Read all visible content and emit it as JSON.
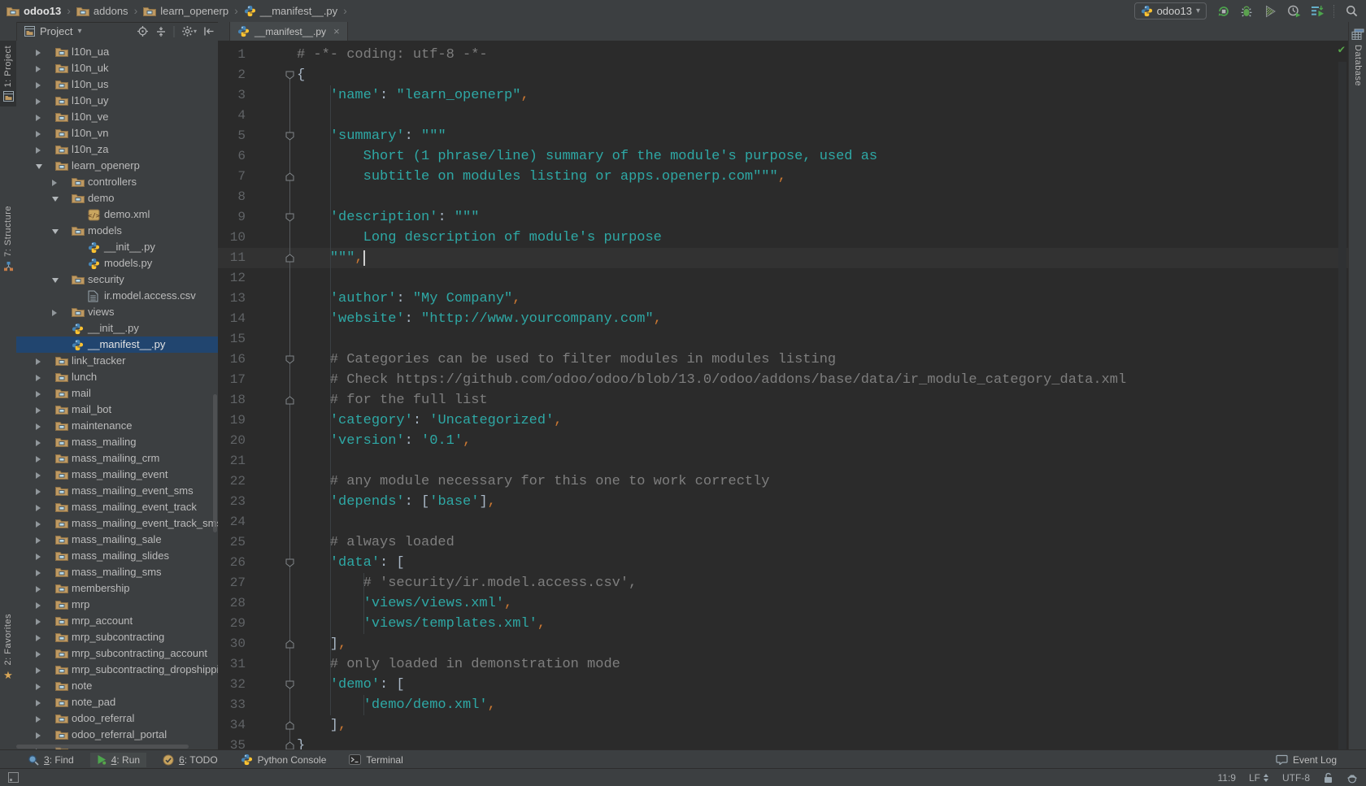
{
  "colors": {
    "panel_bg": "#3C3F41",
    "editor_bg": "#2B2B2B",
    "selection_blue": "#21456F",
    "string_teal": "#2EA8A5",
    "comment_gray": "#7E7E7E",
    "comma_orange": "#CC7832",
    "punct_gray": "#A9B7C6",
    "run_green": "#4DA54D",
    "check_green": "#57A64A",
    "folder_tan": "#BE9962"
  },
  "breadcrumb": {
    "items": [
      {
        "label": "odoo13",
        "icon": "folder",
        "bold": true
      },
      {
        "label": "addons",
        "icon": "folder"
      },
      {
        "label": "learn_openerp",
        "icon": "folder"
      },
      {
        "label": "__manifest__.py",
        "icon": "python"
      }
    ]
  },
  "run_area": {
    "config_label": "odoo13",
    "config_icon": "python",
    "dropdown_caret": "▾",
    "buttons": [
      "rerun",
      "debug",
      "coverage",
      "profile",
      "services"
    ],
    "search_button": "search-everywhere"
  },
  "left_stripe": {
    "top": [
      {
        "label": "1: Project",
        "icon": "project-tool",
        "active": true
      },
      {
        "label": "7: Structure",
        "icon": "structure-tool",
        "active": false
      }
    ],
    "bottom": [
      {
        "label": "2: Favorites",
        "icon": "favorites-star",
        "active": false
      }
    ]
  },
  "right_stripe": {
    "items": [
      {
        "label": "Database",
        "icon": "database-tool"
      }
    ]
  },
  "project_panel": {
    "title": "Project",
    "title_icon": "project-tool",
    "caret": "▾",
    "header_icons": [
      "locate",
      "collapse-all",
      "separator",
      "settings",
      "hide-panel"
    ],
    "tree": [
      {
        "label": "l10n_ua",
        "level": 1,
        "icon": "folder",
        "arrow": "collapsed"
      },
      {
        "label": "l10n_uk",
        "level": 1,
        "icon": "folder",
        "arrow": "collapsed"
      },
      {
        "label": "l10n_us",
        "level": 1,
        "icon": "folder",
        "arrow": "collapsed"
      },
      {
        "label": "l10n_uy",
        "level": 1,
        "icon": "folder",
        "arrow": "collapsed"
      },
      {
        "label": "l10n_ve",
        "level": 1,
        "icon": "folder",
        "arrow": "collapsed"
      },
      {
        "label": "l10n_vn",
        "level": 1,
        "icon": "folder",
        "arrow": "collapsed"
      },
      {
        "label": "l10n_za",
        "level": 1,
        "icon": "folder",
        "arrow": "collapsed"
      },
      {
        "label": "learn_openerp",
        "level": 1,
        "icon": "folder",
        "arrow": "expanded"
      },
      {
        "label": "controllers",
        "level": 2,
        "icon": "folder",
        "arrow": "collapsed"
      },
      {
        "label": "demo",
        "level": 2,
        "icon": "folder",
        "arrow": "expanded"
      },
      {
        "label": "demo.xml",
        "level": 3,
        "icon": "xml",
        "arrow": null
      },
      {
        "label": "models",
        "level": 2,
        "icon": "folder",
        "arrow": "expanded"
      },
      {
        "label": "__init__.py",
        "level": 3,
        "icon": "python",
        "arrow": null
      },
      {
        "label": "models.py",
        "level": 3,
        "icon": "python",
        "arrow": null
      },
      {
        "label": "security",
        "level": 2,
        "icon": "folder",
        "arrow": "expanded"
      },
      {
        "label": "ir.model.access.csv",
        "level": 3,
        "icon": "csv",
        "arrow": null
      },
      {
        "label": "views",
        "level": 2,
        "icon": "folder",
        "arrow": "collapsed"
      },
      {
        "label": "__init__.py",
        "level": 2,
        "icon": "python",
        "arrow": null
      },
      {
        "label": "__manifest__.py",
        "level": 2,
        "icon": "python",
        "arrow": null,
        "selected": true
      },
      {
        "label": "link_tracker",
        "level": 1,
        "icon": "folder",
        "arrow": "collapsed"
      },
      {
        "label": "lunch",
        "level": 1,
        "icon": "folder",
        "arrow": "collapsed"
      },
      {
        "label": "mail",
        "level": 1,
        "icon": "folder",
        "arrow": "collapsed"
      },
      {
        "label": "mail_bot",
        "level": 1,
        "icon": "folder",
        "arrow": "collapsed"
      },
      {
        "label": "maintenance",
        "level": 1,
        "icon": "folder",
        "arrow": "collapsed"
      },
      {
        "label": "mass_mailing",
        "level": 1,
        "icon": "folder",
        "arrow": "collapsed"
      },
      {
        "label": "mass_mailing_crm",
        "level": 1,
        "icon": "folder",
        "arrow": "collapsed"
      },
      {
        "label": "mass_mailing_event",
        "level": 1,
        "icon": "folder",
        "arrow": "collapsed"
      },
      {
        "label": "mass_mailing_event_sms",
        "level": 1,
        "icon": "folder",
        "arrow": "collapsed"
      },
      {
        "label": "mass_mailing_event_track",
        "level": 1,
        "icon": "folder",
        "arrow": "collapsed"
      },
      {
        "label": "mass_mailing_event_track_sms",
        "level": 1,
        "icon": "folder",
        "arrow": "collapsed"
      },
      {
        "label": "mass_mailing_sale",
        "level": 1,
        "icon": "folder",
        "arrow": "collapsed"
      },
      {
        "label": "mass_mailing_slides",
        "level": 1,
        "icon": "folder",
        "arrow": "collapsed"
      },
      {
        "label": "mass_mailing_sms",
        "level": 1,
        "icon": "folder",
        "arrow": "collapsed"
      },
      {
        "label": "membership",
        "level": 1,
        "icon": "folder",
        "arrow": "collapsed"
      },
      {
        "label": "mrp",
        "level": 1,
        "icon": "folder",
        "arrow": "collapsed"
      },
      {
        "label": "mrp_account",
        "level": 1,
        "icon": "folder",
        "arrow": "collapsed"
      },
      {
        "label": "mrp_subcontracting",
        "level": 1,
        "icon": "folder",
        "arrow": "collapsed"
      },
      {
        "label": "mrp_subcontracting_account",
        "level": 1,
        "icon": "folder",
        "arrow": "collapsed"
      },
      {
        "label": "mrp_subcontracting_dropshipping",
        "level": 1,
        "icon": "folder",
        "arrow": "collapsed"
      },
      {
        "label": "note",
        "level": 1,
        "icon": "folder",
        "arrow": "collapsed"
      },
      {
        "label": "note_pad",
        "level": 1,
        "icon": "folder",
        "arrow": "collapsed"
      },
      {
        "label": "odoo_referral",
        "level": 1,
        "icon": "folder",
        "arrow": "collapsed"
      },
      {
        "label": "odoo_referral_portal",
        "level": 1,
        "icon": "folder",
        "arrow": "collapsed"
      },
      {
        "label": "",
        "level": 1,
        "icon": "folder",
        "arrow": "collapsed",
        "partial": true
      }
    ]
  },
  "editor": {
    "tab": {
      "label": "__manifest__.py",
      "icon": "python",
      "close_glyph": "×"
    },
    "inspection_status_icon": "checkmark",
    "caret": {
      "line": 11,
      "col": 9
    },
    "lines": [
      {
        "n": 1,
        "fold": null,
        "tokens": [
          [
            "c",
            "# -*- coding: utf-8 -*-"
          ]
        ]
      },
      {
        "n": 2,
        "fold": "start",
        "tokens": [
          [
            "p",
            "{"
          ]
        ]
      },
      {
        "n": 3,
        "fold": null,
        "tokens": [
          [
            "p",
            "    "
          ],
          [
            "s",
            "'name'"
          ],
          [
            "p",
            ": "
          ],
          [
            "s",
            "\"learn_openerp\""
          ],
          [
            "o",
            ","
          ]
        ]
      },
      {
        "n": 4,
        "fold": null,
        "tokens": []
      },
      {
        "n": 5,
        "fold": "start",
        "tokens": [
          [
            "p",
            "    "
          ],
          [
            "s",
            "'summary'"
          ],
          [
            "p",
            ": "
          ],
          [
            "s",
            "\"\"\""
          ]
        ]
      },
      {
        "n": 6,
        "fold": null,
        "tokens": [
          [
            "s",
            "        Short (1 phrase/line) summary of the module's purpose, used as"
          ]
        ]
      },
      {
        "n": 7,
        "fold": "end",
        "tokens": [
          [
            "s",
            "        subtitle on modules listing or apps.openerp.com\"\"\""
          ],
          [
            "o",
            ","
          ]
        ]
      },
      {
        "n": 8,
        "fold": null,
        "tokens": []
      },
      {
        "n": 9,
        "fold": "start",
        "tokens": [
          [
            "p",
            "    "
          ],
          [
            "s",
            "'description'"
          ],
          [
            "p",
            ": "
          ],
          [
            "s",
            "\"\"\""
          ]
        ]
      },
      {
        "n": 10,
        "fold": null,
        "tokens": [
          [
            "s",
            "        Long description of module's purpose"
          ]
        ]
      },
      {
        "n": 11,
        "fold": "end",
        "current": true,
        "tokens": [
          [
            "p",
            "    "
          ],
          [
            "s",
            "\"\"\""
          ],
          [
            "o",
            ","
          ]
        ]
      },
      {
        "n": 12,
        "fold": null,
        "tokens": []
      },
      {
        "n": 13,
        "fold": null,
        "tokens": [
          [
            "p",
            "    "
          ],
          [
            "s",
            "'author'"
          ],
          [
            "p",
            ": "
          ],
          [
            "s",
            "\"My Company\""
          ],
          [
            "o",
            ","
          ]
        ]
      },
      {
        "n": 14,
        "fold": null,
        "tokens": [
          [
            "p",
            "    "
          ],
          [
            "s",
            "'website'"
          ],
          [
            "p",
            ": "
          ],
          [
            "s",
            "\"http://www.yourcompany.com\""
          ],
          [
            "o",
            ","
          ]
        ]
      },
      {
        "n": 15,
        "fold": null,
        "tokens": []
      },
      {
        "n": 16,
        "fold": "start",
        "tokens": [
          [
            "c",
            "    # Categories can be used to filter modules in modules listing"
          ]
        ]
      },
      {
        "n": 17,
        "fold": null,
        "tokens": [
          [
            "c",
            "    # Check https://github.com/odoo/odoo/blob/13.0/odoo/addons/base/data/ir_module_category_data.xml"
          ]
        ]
      },
      {
        "n": 18,
        "fold": "end",
        "tokens": [
          [
            "c",
            "    # for the full list"
          ]
        ]
      },
      {
        "n": 19,
        "fold": null,
        "tokens": [
          [
            "p",
            "    "
          ],
          [
            "s",
            "'category'"
          ],
          [
            "p",
            ": "
          ],
          [
            "s",
            "'Uncategorized'"
          ],
          [
            "o",
            ","
          ]
        ]
      },
      {
        "n": 20,
        "fold": null,
        "tokens": [
          [
            "p",
            "    "
          ],
          [
            "s",
            "'version'"
          ],
          [
            "p",
            ": "
          ],
          [
            "s",
            "'0.1'"
          ],
          [
            "o",
            ","
          ]
        ]
      },
      {
        "n": 21,
        "fold": null,
        "tokens": []
      },
      {
        "n": 22,
        "fold": null,
        "tokens": [
          [
            "c",
            "    # any module necessary for this one to work correctly"
          ]
        ]
      },
      {
        "n": 23,
        "fold": null,
        "tokens": [
          [
            "p",
            "    "
          ],
          [
            "s",
            "'depends'"
          ],
          [
            "p",
            ": ["
          ],
          [
            "s",
            "'base'"
          ],
          [
            "p",
            "]"
          ],
          [
            "o",
            ","
          ]
        ]
      },
      {
        "n": 24,
        "fold": null,
        "tokens": []
      },
      {
        "n": 25,
        "fold": null,
        "tokens": [
          [
            "c",
            "    # always loaded"
          ]
        ]
      },
      {
        "n": 26,
        "fold": "start",
        "tokens": [
          [
            "p",
            "    "
          ],
          [
            "s",
            "'data'"
          ],
          [
            "p",
            ": ["
          ]
        ]
      },
      {
        "n": 27,
        "fold": null,
        "tokens": [
          [
            "c",
            "        # 'security/ir.model.access.csv',"
          ]
        ]
      },
      {
        "n": 28,
        "fold": null,
        "tokens": [
          [
            "s",
            "        'views/views.xml'"
          ],
          [
            "o",
            ","
          ]
        ]
      },
      {
        "n": 29,
        "fold": null,
        "tokens": [
          [
            "s",
            "        'views/templates.xml'"
          ],
          [
            "o",
            ","
          ]
        ]
      },
      {
        "n": 30,
        "fold": "end",
        "tokens": [
          [
            "p",
            "    ]"
          ],
          [
            "o",
            ","
          ]
        ]
      },
      {
        "n": 31,
        "fold": null,
        "tokens": [
          [
            "c",
            "    # only loaded in demonstration mode"
          ]
        ]
      },
      {
        "n": 32,
        "fold": "start",
        "tokens": [
          [
            "p",
            "    "
          ],
          [
            "s",
            "'demo'"
          ],
          [
            "p",
            ": ["
          ]
        ]
      },
      {
        "n": 33,
        "fold": null,
        "tokens": [
          [
            "s",
            "        'demo/demo.xml'"
          ],
          [
            "o",
            ","
          ]
        ]
      },
      {
        "n": 34,
        "fold": "end",
        "tokens": [
          [
            "p",
            "    ]"
          ],
          [
            "o",
            ","
          ]
        ]
      },
      {
        "n": 35,
        "fold": "end",
        "tokens": [
          [
            "p",
            "}"
          ]
        ]
      }
    ]
  },
  "bottom_bar": {
    "left": [
      {
        "num": "3",
        "label": "Find",
        "icon": "find",
        "active": false
      },
      {
        "num": "4",
        "label": "Run",
        "icon": "run",
        "active": true
      },
      {
        "num": "6",
        "label": "TODO",
        "icon": "todo",
        "active": false
      },
      {
        "num": null,
        "label": "Python Console",
        "icon": "python",
        "active": false
      },
      {
        "num": null,
        "label": "Terminal",
        "icon": "terminal",
        "active": false
      }
    ],
    "right": [
      {
        "label": "Event Log",
        "icon": "event-log"
      }
    ]
  },
  "status_bar": {
    "left_icon": "toolwindow-switcher",
    "items": [
      {
        "name": "caret-position",
        "label": "11:9"
      },
      {
        "name": "line-separator",
        "label": "LF",
        "icon": "updown"
      },
      {
        "name": "file-encoding",
        "label": "UTF-8"
      },
      {
        "name": "file-lock",
        "label": "",
        "icon": "unlock"
      },
      {
        "name": "highlighting-level",
        "label": "",
        "icon": "hector"
      }
    ]
  }
}
